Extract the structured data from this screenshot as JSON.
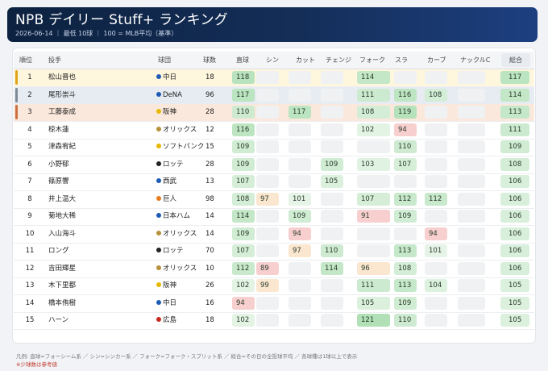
{
  "header": {
    "title": "NPB デイリー Stuff+ ランキング",
    "subtitle": "2026-06-14 ｜ 最低 10球 ｜ 100 = MLB平均（基準）"
  },
  "columns": [
    "順位",
    "投手",
    "球団",
    "球数",
    "直球",
    "シン",
    "カット",
    "チェンジ",
    "フォーク",
    "スラ",
    "カーブ",
    "ナックルC",
    "総合"
  ],
  "rows": [
    {
      "rank": "1",
      "name": "松山晋也",
      "team": "中日",
      "team_color": "#1d5bb5",
      "pitches": "18",
      "vals": [
        "118",
        "",
        "",
        "",
        "114",
        "",
        "",
        ""
      ],
      "total": "117",
      "highlight": "gold"
    },
    {
      "rank": "2",
      "name": "尾形崇斗",
      "team": "DeNA",
      "team_color": "#1d5bb5",
      "pitches": "96",
      "vals": [
        "117",
        "",
        "",
        "",
        "111",
        "116",
        "108",
        ""
      ],
      "total": "114",
      "highlight": "silver"
    },
    {
      "rank": "3",
      "name": "工藤泰成",
      "team": "阪神",
      "team_color": "#e7b800",
      "pitches": "28",
      "vals": [
        "110",
        "",
        "117",
        "",
        "108",
        "119",
        "",
        ""
      ],
      "total": "113",
      "highlight": "bronze"
    },
    {
      "rank": "4",
      "name": "椋木蓮",
      "team": "オリックス",
      "team_color": "#b8903a",
      "pitches": "12",
      "vals": [
        "116",
        "",
        "",
        "",
        "102",
        "94",
        "",
        ""
      ],
      "total": "111",
      "highlight": ""
    },
    {
      "rank": "5",
      "name": "津森宥紀",
      "team": "ソフトバンク",
      "team_color": "#e7b800",
      "pitches": "15",
      "vals": [
        "109",
        "",
        "",
        "",
        "",
        "110",
        "",
        ""
      ],
      "total": "109",
      "highlight": ""
    },
    {
      "rank": "6",
      "name": "小野郁",
      "team": "ロッテ",
      "team_color": "#222222",
      "pitches": "28",
      "vals": [
        "109",
        "",
        "",
        "109",
        "103",
        "107",
        "",
        ""
      ],
      "total": "108",
      "highlight": ""
    },
    {
      "rank": "7",
      "name": "篠原響",
      "team": "西武",
      "team_color": "#1d5bb5",
      "pitches": "13",
      "vals": [
        "107",
        "",
        "",
        "105",
        "",
        "",
        "",
        ""
      ],
      "total": "106",
      "highlight": ""
    },
    {
      "rank": "8",
      "name": "井上温大",
      "team": "巨人",
      "team_color": "#e87a1a",
      "pitches": "98",
      "vals": [
        "108",
        "97",
        "101",
        "",
        "107",
        "112",
        "112",
        ""
      ],
      "total": "106",
      "highlight": ""
    },
    {
      "rank": "9",
      "name": "菊地大稀",
      "team": "日本ハム",
      "team_color": "#1d5bb5",
      "pitches": "14",
      "vals": [
        "114",
        "",
        "109",
        "",
        "91",
        "109",
        "",
        ""
      ],
      "total": "106",
      "highlight": ""
    },
    {
      "rank": "10",
      "name": "入山海斗",
      "team": "オリックス",
      "team_color": "#b8903a",
      "pitches": "14",
      "vals": [
        "109",
        "",
        "94",
        "",
        "",
        "",
        "94",
        ""
      ],
      "total": "106",
      "highlight": ""
    },
    {
      "rank": "11",
      "name": "ロング",
      "team": "ロッテ",
      "team_color": "#222222",
      "pitches": "70",
      "vals": [
        "107",
        "",
        "97",
        "110",
        "",
        "113",
        "101",
        ""
      ],
      "total": "106",
      "highlight": ""
    },
    {
      "rank": "12",
      "name": "吉田輝星",
      "team": "オリックス",
      "team_color": "#b8903a",
      "pitches": "10",
      "vals": [
        "112",
        "89",
        "",
        "114",
        "96",
        "108",
        "",
        ""
      ],
      "total": "106",
      "highlight": ""
    },
    {
      "rank": "13",
      "name": "木下里都",
      "team": "阪神",
      "team_color": "#e7b800",
      "pitches": "26",
      "vals": [
        "102",
        "99",
        "",
        "",
        "111",
        "113",
        "104",
        ""
      ],
      "total": "105",
      "highlight": ""
    },
    {
      "rank": "14",
      "name": "橋本侑樹",
      "team": "中日",
      "team_color": "#1d5bb5",
      "pitches": "16",
      "vals": [
        "94",
        "",
        "",
        "",
        "105",
        "109",
        "",
        ""
      ],
      "total": "105",
      "highlight": ""
    },
    {
      "rank": "15",
      "name": "ハーン",
      "team": "広島",
      "team_color": "#c8281e",
      "pitches": "18",
      "vals": [
        "102",
        "",
        "",
        "",
        "121",
        "110",
        "",
        ""
      ],
      "total": "105",
      "highlight": ""
    }
  ],
  "footer": {
    "legend": "凡例: 直球=フォーシーム系 ／ シン=シンカー系 ／ フォーク=フォーク・スプリット系 ／ 総合=その日の全投球平均 ／ 各球種は1球以上で表示",
    "note": "※少球数は参考値"
  }
}
